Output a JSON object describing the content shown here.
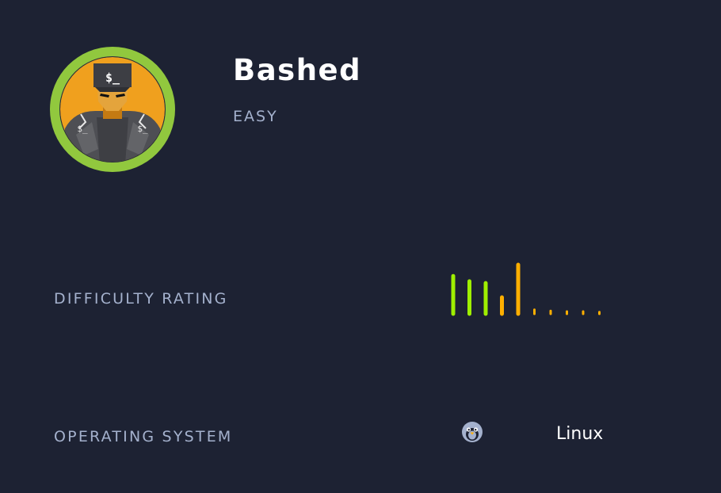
{
  "machine": {
    "name": "Bashed",
    "difficulty": "EASY"
  },
  "rows": {
    "rating_label": "DIFFICULTY RATING",
    "os_label": "OPERATING SYSTEM",
    "os_value": "Linux",
    "os_icon": "penguin-icon"
  },
  "rating": {
    "bars": [
      64,
      55,
      52,
      28,
      83,
      7,
      5,
      4,
      4,
      3
    ],
    "colors": [
      "#9fef00",
      "#9fef00",
      "#9fef00",
      "#ffaf00",
      "#ffaf00",
      "#ffaf00",
      "#ffaf00",
      "#ffaf00",
      "#ffaf00",
      "#ffaf00"
    ]
  },
  "colors": {
    "background": "#1d2233",
    "ring": "#9fef00",
    "accent": "#ffaf00",
    "label": "#a4b1cd",
    "text": "#ffffff"
  }
}
